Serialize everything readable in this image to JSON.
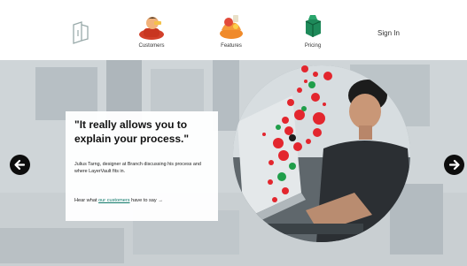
{
  "nav": {
    "items": [
      {
        "label": "Customers"
      },
      {
        "label": "Features"
      },
      {
        "label": "Pricing"
      }
    ],
    "signin_label": "Sign In"
  },
  "hero": {
    "quote": "\"It really allows you to explain your process.\"",
    "attribution": "Julius Tarng, designer at Branch discussing his process and where LayerVault fits in.",
    "cta_prefix": "Hear what",
    "cta_link": "our customers",
    "cta_suffix": "have to say",
    "cta_arrow": "→"
  },
  "colors": {
    "accent_link": "#117a6a",
    "dot_red": "#e3262e",
    "dot_green": "#1f9e4a",
    "arrow_bg": "#0d0d0d"
  }
}
